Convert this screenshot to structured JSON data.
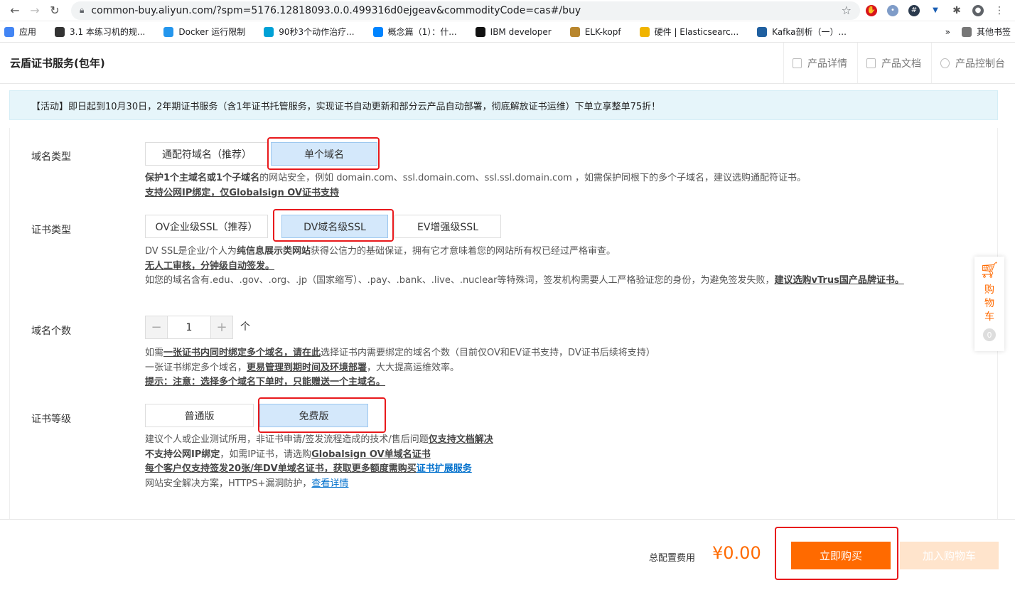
{
  "browser": {
    "url": "common-buy.aliyun.com/?spm=5176.12818093.0.0.499316d0ejgeav&commodityCode=cas#/buy",
    "bookmarks": [
      {
        "label": "应用",
        "icon": "apps-grid-icon",
        "color": "#4285f4"
      },
      {
        "label": "3.1 本练习机的规...",
        "icon": "book-icon",
        "color": "#333333"
      },
      {
        "label": "Docker 运行限制",
        "icon": "docker-icon",
        "color": "#2496ed"
      },
      {
        "label": "90秒3个动作治疗...",
        "icon": "bilibili-icon",
        "color": "#00a1d6"
      },
      {
        "label": "概念篇（1）：什...",
        "icon": "zhihu-icon",
        "color": "#0084ff"
      },
      {
        "label": "IBM developer",
        "icon": "ibm-icon",
        "color": "#111111"
      },
      {
        "label": "ELK-kopf",
        "icon": "kopf-icon",
        "color": "#b8862e"
      },
      {
        "label": "硬件 | Elasticsearc...",
        "icon": "elastic-icon",
        "color": "#f0b400"
      },
      {
        "label": "Kafka剖析（一）...",
        "icon": "infoq-icon",
        "color": "#2060a0"
      }
    ],
    "bookmarks_more": "»",
    "other_bookmarks": "其他书签"
  },
  "header": {
    "title": "云盾证书服务(包年)",
    "links": [
      "产品详情",
      "产品文档",
      "产品控制台"
    ]
  },
  "banner": "【活动】即日起到10月30日，2年期证书服务（含1年证书托管服务，实现证书自动更新和部分云产品自动部署，彻底解放证书运维）下单立享整单75折！",
  "domain_type": {
    "label": "域名类型",
    "options": [
      "通配符域名（推荐）",
      "单个域名"
    ],
    "selected": "单个域名",
    "desc_line1_bold": "保护1个主域名或1个子域名",
    "desc_line1_rest": "的网站安全，例如 domain.com、ssl.domain.com、ssl.ssl.domain.com ，如需保护同根下的多个子域名，建议选购通配符证书。",
    "desc_line2": "支持公网IP绑定，仅Globalsign OV证书支持"
  },
  "cert_type": {
    "label": "证书类型",
    "options": [
      "OV企业级SSL（推荐）",
      "DV域名级SSL",
      "EV增强级SSL"
    ],
    "selected": "DV域名级SSL",
    "desc_line1_a": "DV SSL是企业/个人为",
    "desc_line1_bold": "纯信息展示类网站",
    "desc_line1_b": "获得公信力的基础保证，拥有它才意味着您的网站所有权已经过严格审查。",
    "desc_line2": "无人工审核，分钟级自动签发。",
    "desc_line3_a": "如您的域名含有.edu、.gov、.org、.jp（国家缩写）、.pay、.bank、.live、.nuclear等特殊词，签发机构需要人工严格验证您的身份，为避免签发失败，",
    "desc_line3_bold": "建议选购vTrus国产品牌证书。"
  },
  "domain_count": {
    "label": "域名个数",
    "minus": "−",
    "value": "1",
    "plus": "+",
    "unit": "个",
    "desc_line1_a": "如需",
    "desc_line1_bold": "一张证书内同时绑定多个域名，请在此",
    "desc_line1_b": "选择证书内需要绑定的域名个数（目前仅OV和EV证书支持，DV证书后续将支持）",
    "desc_line2_a": "一张证书绑定多个域名，",
    "desc_line2_bold": "更易管理到期时间及环境部署",
    "desc_line2_b": "，大大提高运维效率。",
    "desc_line3": "提示：注意：选择多个域名下单时，只能赠送一个主域名。"
  },
  "cert_level": {
    "label": "证书等级",
    "options": [
      "普通版",
      "免费版"
    ],
    "selected": "免费版",
    "desc_line1_a": "建议个人或企业测试所用，非证书申请/签发流程造成的技术/售后问题",
    "desc_line1_bold": "仅支持文档解决",
    "desc_line2_a": "不支持公网IP绑定",
    "desc_line2_b": "，如需IP证书，请选购",
    "desc_line2_bold": "Globalsign OV单域名证书",
    "desc_line3_bold": "每个客户仅支持签发20张/年DV单域名证书，获取更多额度需购买",
    "desc_line3_link": "证书扩展服务",
    "desc_line4_a": "网站安全解决方案，HTTPS+漏洞防护，",
    "desc_line4_link": "查看详情"
  },
  "cart_widget": {
    "label": "购物车",
    "count": "0"
  },
  "footer": {
    "total_label": "总配置费用",
    "total_value": "¥0.00",
    "buy_label": "立即购买",
    "add_cart_label": "加入购物车"
  },
  "colors": {
    "accent": "#ff6a00",
    "highlight": "#e8191c",
    "selected_bg": "#d4e8fb"
  }
}
